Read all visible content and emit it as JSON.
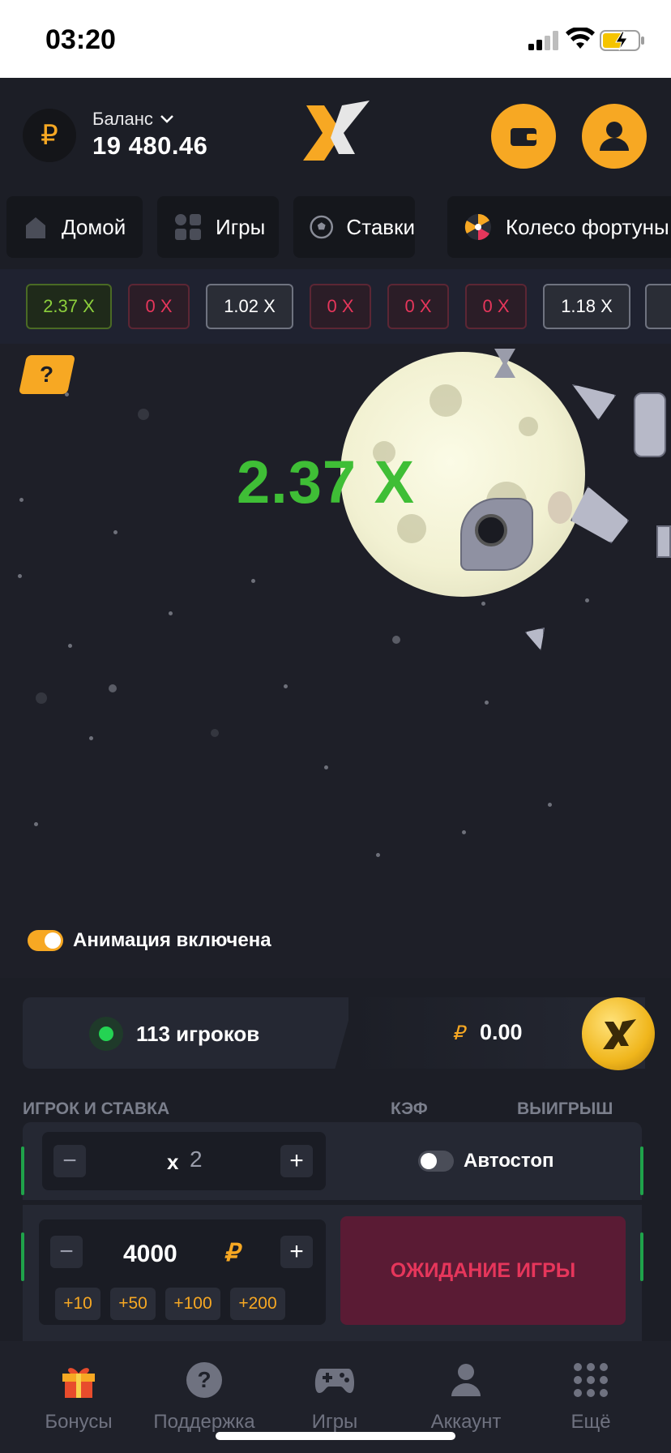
{
  "status_bar": {
    "time": "03:20"
  },
  "header": {
    "balance_label": "Баланс",
    "balance_amount": "19 480.46",
    "currency_symbol": "₽"
  },
  "nav_tabs": [
    {
      "label": "Домой",
      "icon": "home-icon"
    },
    {
      "label": "Игры",
      "icon": "games-grid-icon"
    },
    {
      "label": "Ставки",
      "icon": "soccer-ball-icon"
    },
    {
      "label": "Колесо фортуны",
      "icon": "fortune-wheel-icon"
    }
  ],
  "history": [
    {
      "label": "2.37 X",
      "tone": "green"
    },
    {
      "label": "0 X",
      "tone": "red"
    },
    {
      "label": "1.02 X",
      "tone": "grey"
    },
    {
      "label": "0 X",
      "tone": "red"
    },
    {
      "label": "0 X",
      "tone": "red"
    },
    {
      "label": "0 X",
      "tone": "red"
    },
    {
      "label": "1.18 X",
      "tone": "grey"
    }
  ],
  "game": {
    "help_label": "?",
    "multiplier": "2.37 X",
    "animation_label": "Анимация включена",
    "animation_on": true
  },
  "stats": {
    "players": "113 игроков",
    "currency_symbol": "₽",
    "pot": "0.00"
  },
  "columns": {
    "player": "ИГРОК И СТАВКА",
    "coef": "КЭФ",
    "win": "ВЫИГРЫШ"
  },
  "bet": {
    "mult_prefix": "x",
    "mult_value": "2",
    "autostop_label": "Автостоп",
    "amount": "4000",
    "currency_symbol": "₽",
    "quick": [
      "+10",
      "+50",
      "+100",
      "+200"
    ],
    "action_label": "ОЖИДАНИЕ ИГРЫ"
  },
  "bottom_nav": [
    {
      "label": "Бонусы",
      "icon": "gift-icon"
    },
    {
      "label": "Поддержка",
      "icon": "help-circle-icon"
    },
    {
      "label": "Игры",
      "icon": "gamepad-icon"
    },
    {
      "label": "Аккаунт",
      "icon": "person-icon"
    },
    {
      "label": "Ещё",
      "icon": "grid-dots-icon"
    }
  ],
  "colors": {
    "accent": "#f7a823",
    "background": "#1c1e26",
    "win_green": "#3fbe36",
    "loss_red": "#e6365b"
  }
}
